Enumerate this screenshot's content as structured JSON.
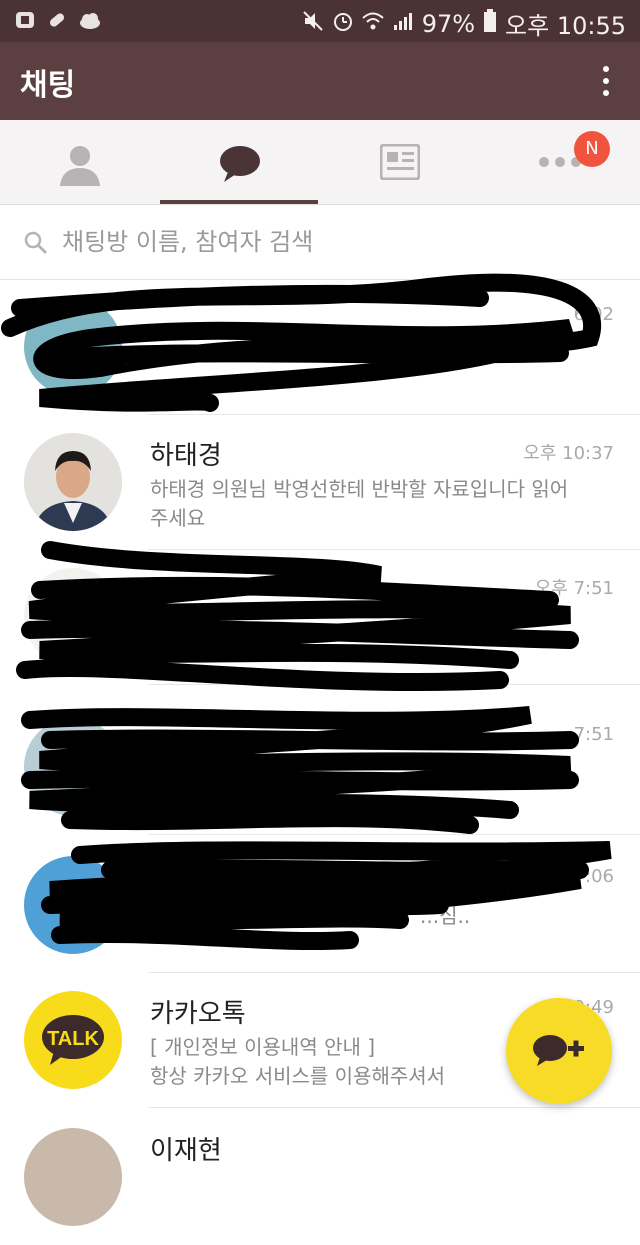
{
  "status_bar": {
    "battery": "97%",
    "time": "오후 10:55"
  },
  "app_bar": {
    "title": "채팅",
    "menu_icon": "more-vert-icon"
  },
  "tabs": [
    {
      "name": "friends",
      "icon": "person-icon"
    },
    {
      "name": "chats",
      "icon": "chat-bubble-icon",
      "selected": true
    },
    {
      "name": "channel",
      "icon": "news-icon"
    },
    {
      "name": "more",
      "icon": "more-horiz-icon",
      "badge": "N"
    }
  ],
  "search": {
    "placeholder": "채팅방 이름, 참여자 검색"
  },
  "chats": [
    {
      "name": "",
      "time": "6:02",
      "message": "",
      "redacted": true
    },
    {
      "name": "하태경",
      "time": "오후 10:37",
      "message": "하태경 의원님 박영선한테 반박할 자료입니다 읽어주세요",
      "redacted": false
    },
    {
      "name": "",
      "time": "오후 7:51",
      "message": "",
      "redacted": true
    },
    {
      "name": "",
      "time": "7:51",
      "message": "",
      "redacted": true
    },
    {
      "name": "",
      "time": "오후 7:06",
      "message": "...심..",
      "redacted": true
    },
    {
      "name": "카카오톡",
      "time": "9:49",
      "message": "[ 개인정보 이용내역 안내 ]\n항상 카카오 서비스를 이용해주셔서",
      "redacted": false
    },
    {
      "name": "이재현",
      "time": "",
      "message": "",
      "redacted": false
    }
  ],
  "kakao_logo_text": "TALK",
  "colors": {
    "status_bar": "#4b3335",
    "app_bar": "#5b3f41",
    "badge": "#f0533e",
    "fab": "#f8db27"
  }
}
